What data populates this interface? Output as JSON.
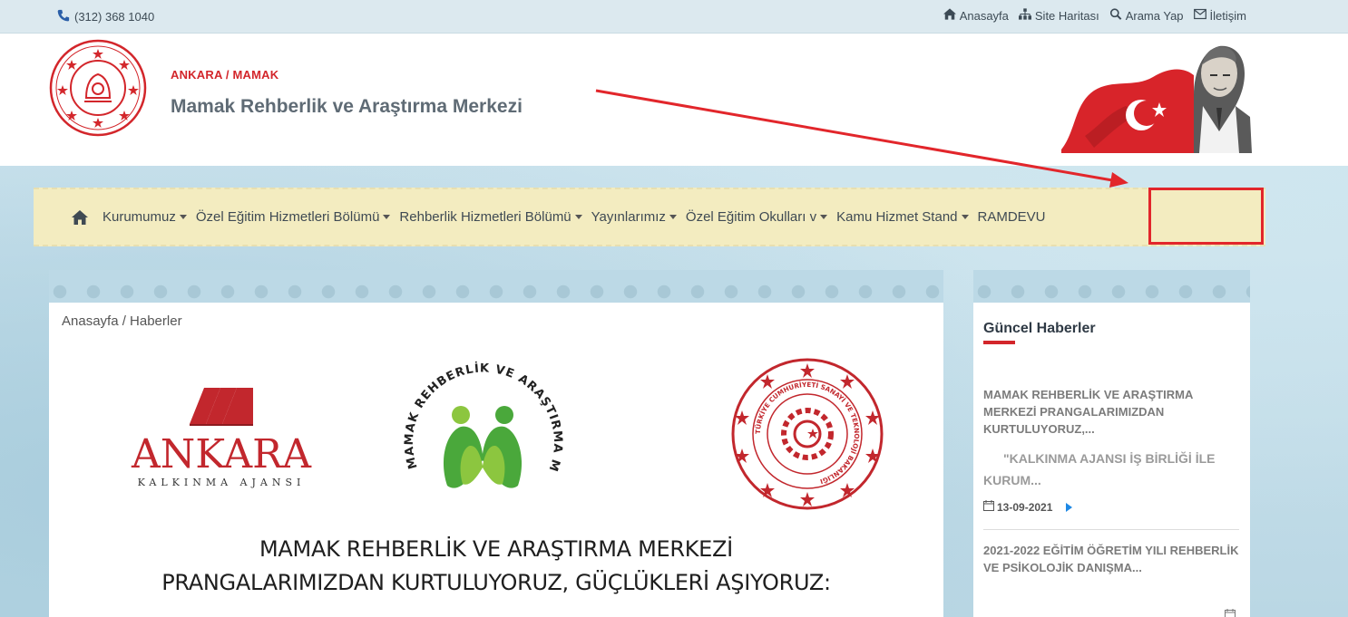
{
  "topbar": {
    "phone": "(312) 368 1040",
    "links": [
      {
        "label": "Anasayfa",
        "icon": "home-icon"
      },
      {
        "label": "Site Haritası",
        "icon": "sitemap-icon"
      },
      {
        "label": "Arama Yap",
        "icon": "search-icon"
      },
      {
        "label": "İletişim",
        "icon": "envelope-icon"
      }
    ]
  },
  "header": {
    "subtitle": "ANKARA / MAMAK",
    "title": "Mamak Rehberlik ve Araştırma Merkezi",
    "seal_text": "TÜRKİYE CUMHURİYETİ MİLLÎ EĞİTİM BAKANLIĞI"
  },
  "nav": {
    "items": [
      {
        "label": "Kurumumuz"
      },
      {
        "label": "Özel Eğitim Hizmetleri Bölümü"
      },
      {
        "label": "Rehberlik Hizmetleri Bölümü"
      },
      {
        "label": "Yayınlarımız"
      },
      {
        "label": "Özel Eğitim Okulları v"
      },
      {
        "label": "Kamu Hizmet Stand"
      }
    ],
    "highlighted": "RAMDEVU"
  },
  "main": {
    "breadcrumb": "Anasayfa  /  Haberler",
    "ankara_logo": {
      "big": "ANKARA",
      "small": "KALKINMA AJANSI"
    },
    "ram_logo_text": "MAMAK REHBERLİK VE ARAŞTIRMA MERKEZİ",
    "sanayi_logo_text": "TÜRKİYE CUMHURİYETİ SANAYİ VE TEKNOLOJİ BAKANLIĞI",
    "headline_line1": "MAMAK REHBERLİK VE ARAŞTIRMA MERKEZİ",
    "headline_line2": "PRANGALARIMIZDAN KURTULUYORUZ, GÜÇLÜKLERİ AŞIYORUZ:"
  },
  "sidebar": {
    "title": "Güncel Haberler",
    "news": [
      {
        "title": "MAMAK REHBERLİK VE ARAŞTIRMA MERKEZİ PRANGALARIMIZDAN KURTULUYORUZ,...",
        "body": "\"KALKINMA AJANSI İŞ BİRLİĞİ İLE KURUM...",
        "date": "13-09-2021"
      },
      {
        "title": "2021-2022 EĞİTİM ÖĞRETİM YILI REHBERLİK VE PSİKOLOJİK DANIŞMA..."
      }
    ]
  },
  "colors": {
    "accent_red": "#d3262b",
    "nav_bg": "#f3ecc0",
    "title_gray": "#5f6b75"
  }
}
